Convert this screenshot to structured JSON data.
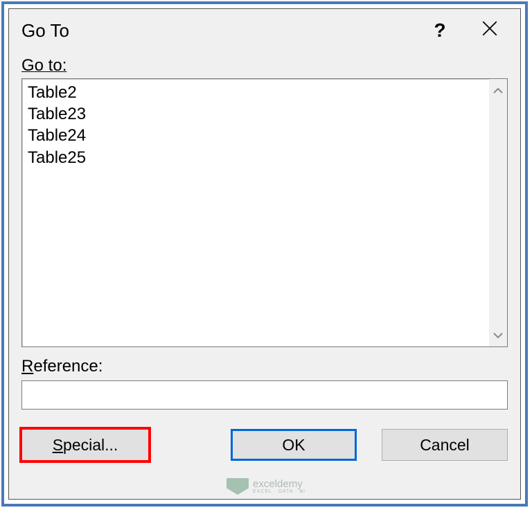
{
  "dialog": {
    "title": "Go To",
    "goto_label": "Go to:",
    "list_items": [
      "Table2",
      "Table23",
      "Table24",
      "Table25"
    ],
    "reference_label": "Reference:",
    "reference_value": "",
    "buttons": {
      "special": "Special...",
      "ok": "OK",
      "cancel": "Cancel"
    }
  },
  "watermark": {
    "main": "exceldemy",
    "sub": "EXCEL · DATA · BI"
  }
}
